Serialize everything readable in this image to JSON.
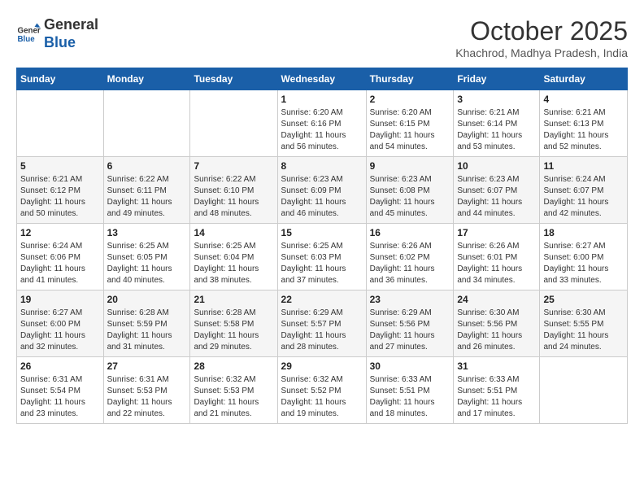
{
  "header": {
    "logo_line1": "General",
    "logo_line2": "Blue",
    "month": "October 2025",
    "location": "Khachrod, Madhya Pradesh, India"
  },
  "weekdays": [
    "Sunday",
    "Monday",
    "Tuesday",
    "Wednesday",
    "Thursday",
    "Friday",
    "Saturday"
  ],
  "weeks": [
    [
      {
        "day": "",
        "info": ""
      },
      {
        "day": "",
        "info": ""
      },
      {
        "day": "",
        "info": ""
      },
      {
        "day": "1",
        "info": "Sunrise: 6:20 AM\nSunset: 6:16 PM\nDaylight: 11 hours\nand 56 minutes."
      },
      {
        "day": "2",
        "info": "Sunrise: 6:20 AM\nSunset: 6:15 PM\nDaylight: 11 hours\nand 54 minutes."
      },
      {
        "day": "3",
        "info": "Sunrise: 6:21 AM\nSunset: 6:14 PM\nDaylight: 11 hours\nand 53 minutes."
      },
      {
        "day": "4",
        "info": "Sunrise: 6:21 AM\nSunset: 6:13 PM\nDaylight: 11 hours\nand 52 minutes."
      }
    ],
    [
      {
        "day": "5",
        "info": "Sunrise: 6:21 AM\nSunset: 6:12 PM\nDaylight: 11 hours\nand 50 minutes."
      },
      {
        "day": "6",
        "info": "Sunrise: 6:22 AM\nSunset: 6:11 PM\nDaylight: 11 hours\nand 49 minutes."
      },
      {
        "day": "7",
        "info": "Sunrise: 6:22 AM\nSunset: 6:10 PM\nDaylight: 11 hours\nand 48 minutes."
      },
      {
        "day": "8",
        "info": "Sunrise: 6:23 AM\nSunset: 6:09 PM\nDaylight: 11 hours\nand 46 minutes."
      },
      {
        "day": "9",
        "info": "Sunrise: 6:23 AM\nSunset: 6:08 PM\nDaylight: 11 hours\nand 45 minutes."
      },
      {
        "day": "10",
        "info": "Sunrise: 6:23 AM\nSunset: 6:07 PM\nDaylight: 11 hours\nand 44 minutes."
      },
      {
        "day": "11",
        "info": "Sunrise: 6:24 AM\nSunset: 6:07 PM\nDaylight: 11 hours\nand 42 minutes."
      }
    ],
    [
      {
        "day": "12",
        "info": "Sunrise: 6:24 AM\nSunset: 6:06 PM\nDaylight: 11 hours\nand 41 minutes."
      },
      {
        "day": "13",
        "info": "Sunrise: 6:25 AM\nSunset: 6:05 PM\nDaylight: 11 hours\nand 40 minutes."
      },
      {
        "day": "14",
        "info": "Sunrise: 6:25 AM\nSunset: 6:04 PM\nDaylight: 11 hours\nand 38 minutes."
      },
      {
        "day": "15",
        "info": "Sunrise: 6:25 AM\nSunset: 6:03 PM\nDaylight: 11 hours\nand 37 minutes."
      },
      {
        "day": "16",
        "info": "Sunrise: 6:26 AM\nSunset: 6:02 PM\nDaylight: 11 hours\nand 36 minutes."
      },
      {
        "day": "17",
        "info": "Sunrise: 6:26 AM\nSunset: 6:01 PM\nDaylight: 11 hours\nand 34 minutes."
      },
      {
        "day": "18",
        "info": "Sunrise: 6:27 AM\nSunset: 6:00 PM\nDaylight: 11 hours\nand 33 minutes."
      }
    ],
    [
      {
        "day": "19",
        "info": "Sunrise: 6:27 AM\nSunset: 6:00 PM\nDaylight: 11 hours\nand 32 minutes."
      },
      {
        "day": "20",
        "info": "Sunrise: 6:28 AM\nSunset: 5:59 PM\nDaylight: 11 hours\nand 31 minutes."
      },
      {
        "day": "21",
        "info": "Sunrise: 6:28 AM\nSunset: 5:58 PM\nDaylight: 11 hours\nand 29 minutes."
      },
      {
        "day": "22",
        "info": "Sunrise: 6:29 AM\nSunset: 5:57 PM\nDaylight: 11 hours\nand 28 minutes."
      },
      {
        "day": "23",
        "info": "Sunrise: 6:29 AM\nSunset: 5:56 PM\nDaylight: 11 hours\nand 27 minutes."
      },
      {
        "day": "24",
        "info": "Sunrise: 6:30 AM\nSunset: 5:56 PM\nDaylight: 11 hours\nand 26 minutes."
      },
      {
        "day": "25",
        "info": "Sunrise: 6:30 AM\nSunset: 5:55 PM\nDaylight: 11 hours\nand 24 minutes."
      }
    ],
    [
      {
        "day": "26",
        "info": "Sunrise: 6:31 AM\nSunset: 5:54 PM\nDaylight: 11 hours\nand 23 minutes."
      },
      {
        "day": "27",
        "info": "Sunrise: 6:31 AM\nSunset: 5:53 PM\nDaylight: 11 hours\nand 22 minutes."
      },
      {
        "day": "28",
        "info": "Sunrise: 6:32 AM\nSunset: 5:53 PM\nDaylight: 11 hours\nand 21 minutes."
      },
      {
        "day": "29",
        "info": "Sunrise: 6:32 AM\nSunset: 5:52 PM\nDaylight: 11 hours\nand 19 minutes."
      },
      {
        "day": "30",
        "info": "Sunrise: 6:33 AM\nSunset: 5:51 PM\nDaylight: 11 hours\nand 18 minutes."
      },
      {
        "day": "31",
        "info": "Sunrise: 6:33 AM\nSunset: 5:51 PM\nDaylight: 11 hours\nand 17 minutes."
      },
      {
        "day": "",
        "info": ""
      }
    ]
  ]
}
